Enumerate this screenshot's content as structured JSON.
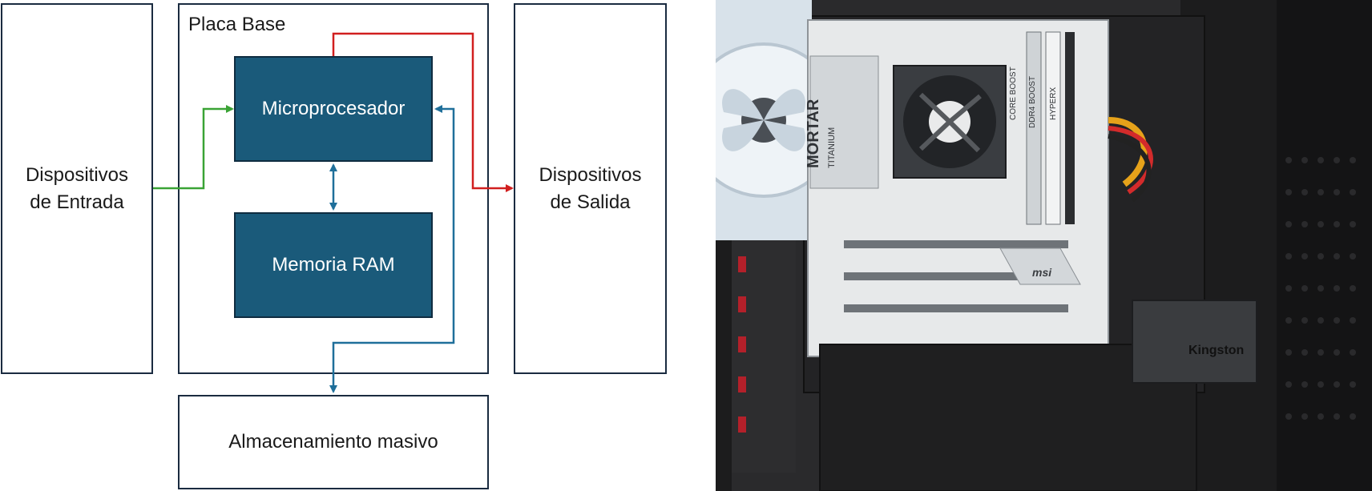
{
  "diagram": {
    "input": {
      "line1": "Dispositivos",
      "line2": "de Entrada"
    },
    "motherboard": {
      "label": "Placa Base"
    },
    "cpu": {
      "label": "Microprocesador"
    },
    "ram": {
      "label": "Memoria RAM"
    },
    "output": {
      "line1": "Dispositivos",
      "line2": "de Salida"
    },
    "storage": {
      "label": "Almacenamiento masivo"
    },
    "colors": {
      "input_arrow": "#3aa335",
      "output_arrow": "#d11f1f",
      "bus_arrow": "#1f6f9a",
      "box_fill": "#1a5a7a"
    }
  },
  "photo": {
    "labels": {
      "brand1": "MORTAR",
      "brand2": "TITANIUM",
      "msi": "msi",
      "ddr4": "DDR4 BOOST",
      "core": "CORE BOOST",
      "hyperx": "HYPERX",
      "kingston": "Kingston"
    }
  }
}
